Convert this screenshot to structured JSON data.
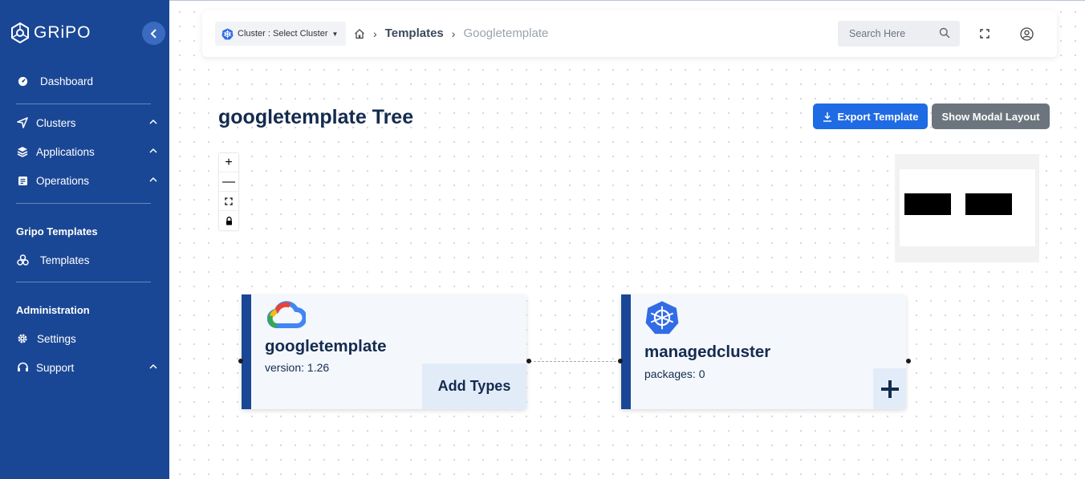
{
  "brand": {
    "name": "GRiPO"
  },
  "sidebar": {
    "dashboard": "Dashboard",
    "clusters": "Clusters",
    "applications": "Applications",
    "operations": "Operations",
    "templates_section": "Gripo Templates",
    "templates": "Templates",
    "administration_section": "Administration",
    "settings": "Settings",
    "support": "Support"
  },
  "topbar": {
    "cluster_select": "Cluster : Select Cluster",
    "breadcrumb": [
      "Templates",
      "Googletemplate"
    ],
    "search_placeholder": "Search Here"
  },
  "page": {
    "title": "googletemplate Tree",
    "export_button": "Export Template",
    "modal_button": "Show Modal Layout"
  },
  "nodes": [
    {
      "name": "googletemplate",
      "subtitle": "version: 1.26",
      "action": "Add Types",
      "icon": "google-cloud-icon"
    },
    {
      "name": "managedcluster",
      "subtitle": "packages: 0",
      "action": "+",
      "icon": "kubernetes-icon"
    }
  ],
  "colors": {
    "sidebar": "#1a4795",
    "primary": "#1f6be3",
    "secondary": "#6c757d"
  }
}
